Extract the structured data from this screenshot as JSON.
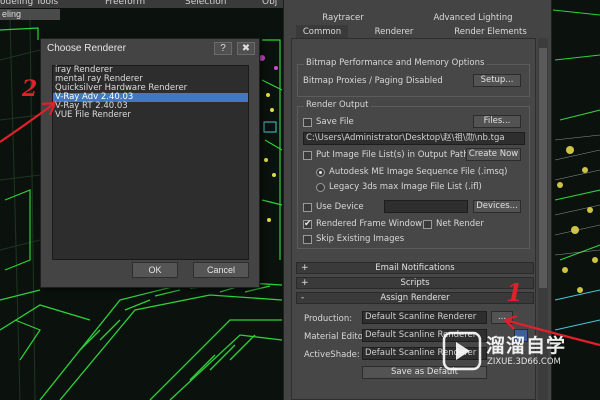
{
  "app": {
    "top_tabs": [
      "odeling Tools",
      "Freeform",
      "Selection",
      "Obj"
    ],
    "sub_tab": "eling"
  },
  "choose_renderer_dialog": {
    "title": "Choose Renderer",
    "help_label": "?",
    "close_label": "✖",
    "items": [
      "iray Renderer",
      "mental ray Renderer",
      "Quicksilver Hardware Renderer",
      "V-Ray Adv 2.40.03",
      "V-Ray RT 2.40.03",
      "VUE File Renderer"
    ],
    "selected_item": "V-Ray Adv 2.40.03",
    "ok_label": "OK",
    "cancel_label": "Cancel"
  },
  "render_setup": {
    "tabs_row1": [
      "Raytracer",
      "Advanced Lighting"
    ],
    "tabs_row2": [
      "Common",
      "Renderer",
      "Render Elements"
    ],
    "active_tab": "Common",
    "bitmap_group": {
      "title": "Bitmap Performance and Memory Options",
      "status": "Bitmap Proxies / Paging Disabled",
      "setup_label": "Setup..."
    },
    "render_output": {
      "title": "Render Output",
      "save_file_label": "Save File",
      "save_file_checked": false,
      "files_label": "Files...",
      "path": "C:\\Users\\Administrator\\Desktop\\赵\\祖\\勋\\nb.tga",
      "put_image_label": "Put Image File List(s) in Output Path(s)",
      "put_image_checked": false,
      "create_now_label": "Create Now",
      "radio_autodesk": "Autodesk ME Image Sequence File (.imsq)",
      "radio_legacy": "Legacy 3ds max Image File List (.ifl)",
      "use_device_label": "Use Device",
      "use_device_checked": false,
      "devices_label": "Devices...",
      "rendered_frame_window_label": "Rendered Frame Window",
      "rendered_frame_window_checked": true,
      "net_render_label": "Net Render",
      "net_render_checked": false,
      "skip_existing_label": "Skip Existing Images",
      "skip_existing_checked": false
    },
    "rollouts": [
      {
        "sign": "+",
        "label": "Email Notifications"
      },
      {
        "sign": "+",
        "label": "Scripts"
      },
      {
        "sign": "-",
        "label": "Assign Renderer"
      }
    ],
    "assign_renderer": {
      "production_label": "Production:",
      "production_value": "Default Scanline Renderer",
      "material_editor_label": "Material Editor:",
      "material_editor_value": "Default Scanline Renderer",
      "activeshade_label": "ActiveShade:",
      "activeshade_value": "Default Scanline Renderer",
      "browse_label": "...",
      "save_default_label": "Save as Default"
    }
  },
  "annotations": {
    "mark_2": "2",
    "mark_1": "1",
    "color": "#e0202a"
  },
  "watermark": {
    "title": "溜溜自学",
    "url": "ZIXUE.3D66.COM"
  },
  "colors": {
    "panel_bg": "#444444",
    "selection": "#3d79c5",
    "scene_green": "#2fd13a",
    "scene_yellow": "#e2d84a"
  }
}
